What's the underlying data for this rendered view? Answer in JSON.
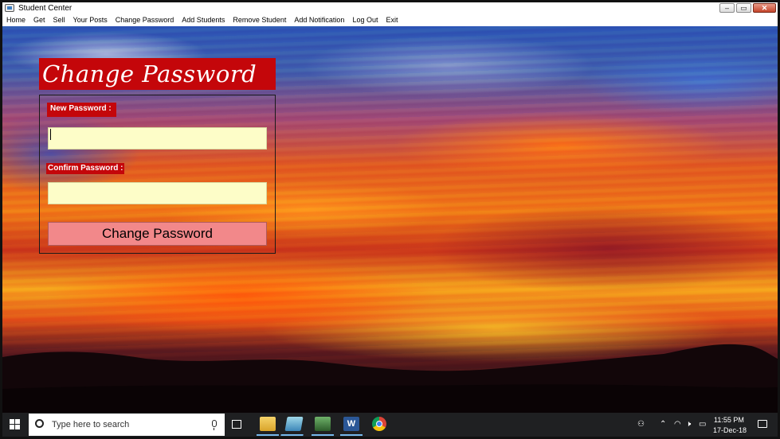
{
  "window": {
    "title": "Student Center",
    "controls": [
      "minimize-icon",
      "maximize-icon",
      "close-icon"
    ]
  },
  "menu": {
    "items": [
      {
        "label": "Home"
      },
      {
        "label": "Get"
      },
      {
        "label": "Sell"
      },
      {
        "label": "Your Posts"
      },
      {
        "label": "Change Password"
      },
      {
        "label": "Add Students"
      },
      {
        "label": "Remove Student"
      },
      {
        "label": "Add Notification"
      },
      {
        "label": "Log Out"
      },
      {
        "label": "Exit"
      }
    ]
  },
  "form": {
    "heading": "Change Password",
    "new_password_label": "New Password :",
    "new_password_value": "",
    "confirm_password_label": "Confirm Password :",
    "confirm_password_value": "",
    "submit_label": "Change Password"
  },
  "colors": {
    "accent_red": "#c4060a",
    "input_bg": "#fdfdc8",
    "button_bg": "#f2888a",
    "taskbar_bg": "#1f2022"
  },
  "taskbar": {
    "search_placeholder": "Type here to search",
    "pinned_apps": [
      "file-explorer-icon",
      "book-app-icon",
      "visual-studio-icon",
      "word-icon",
      "chrome-icon"
    ],
    "word_glyph": "W",
    "tray_icons": [
      "people-icon",
      "chevron-up-icon",
      "wifi-icon",
      "speaker-icon",
      "battery-icon",
      "notification-icon"
    ],
    "time": "11:55 PM",
    "date": "17-Dec-18"
  }
}
